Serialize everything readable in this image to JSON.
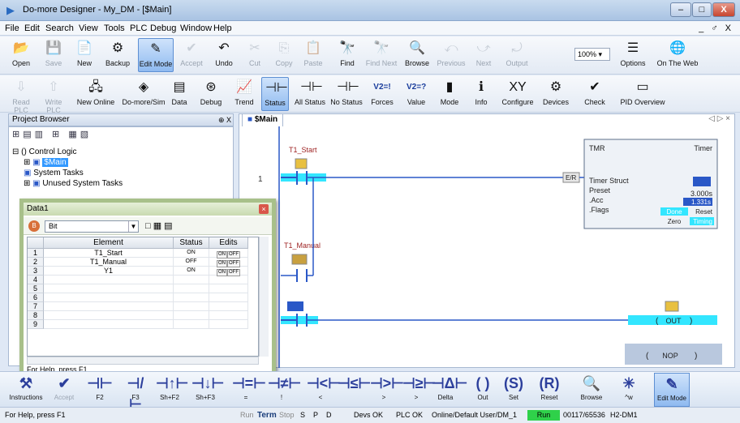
{
  "window": {
    "title": "Do-more Designer - My_DM - [$Main]",
    "min": "–",
    "max": "□",
    "close": "X",
    "mdi_controls": "_ ♂ X"
  },
  "menu": [
    "File",
    "Edit",
    "Search",
    "View",
    "Tools",
    "PLC",
    "Debug",
    "Window",
    "Help"
  ],
  "toolbar1": [
    {
      "label": "Open",
      "icon": "folder-open-icon",
      "glyph": "📂",
      "state": "normal"
    },
    {
      "label": "Save",
      "icon": "save-icon",
      "glyph": "💾",
      "state": "disabled"
    },
    {
      "label": "New",
      "icon": "new-document-icon",
      "glyph": "📄",
      "state": "normal"
    },
    {
      "label": "Backup",
      "icon": "backup-icon",
      "glyph": "⚙",
      "state": "normal"
    },
    {
      "label": "Edit Mode",
      "icon": "edit-mode-icon",
      "glyph": "✎",
      "state": "selected"
    },
    {
      "label": "Accept",
      "icon": "accept-icon",
      "glyph": "✔",
      "state": "disabled"
    },
    {
      "label": "Undo",
      "icon": "undo-icon",
      "glyph": "↶",
      "state": "normal"
    },
    {
      "label": "Cut",
      "icon": "cut-icon",
      "glyph": "✂",
      "state": "disabled"
    },
    {
      "label": "Copy",
      "icon": "copy-icon",
      "glyph": "⎘",
      "state": "disabled"
    },
    {
      "label": "Paste",
      "icon": "paste-icon",
      "glyph": "📋",
      "state": "disabled"
    },
    {
      "label": "Find",
      "icon": "find-icon",
      "glyph": "🔭",
      "state": "normal"
    },
    {
      "label": "Find Next",
      "icon": "find-next-icon",
      "glyph": "🔭",
      "state": "disabled"
    },
    {
      "label": "Browse",
      "icon": "browse-icon",
      "glyph": "🔍",
      "state": "normal"
    },
    {
      "label": "Previous",
      "icon": "previous-icon",
      "glyph": "⤺",
      "state": "disabled"
    },
    {
      "label": "Next",
      "icon": "next-icon",
      "glyph": "⤻",
      "state": "disabled"
    },
    {
      "label": "Output",
      "icon": "output-icon",
      "glyph": "⤾",
      "state": "disabled"
    },
    {
      "label": "Options",
      "icon": "options-icon",
      "glyph": "☰",
      "state": "normal"
    },
    {
      "label": "On The Web",
      "icon": "web-icon",
      "glyph": "🌐",
      "state": "normal"
    }
  ],
  "zoom": "100%",
  "toolbar2": [
    {
      "label": "Read PLC",
      "icon": "read-plc-icon",
      "glyph": "⇩",
      "state": "disabled"
    },
    {
      "label": "Write PLC",
      "icon": "write-plc-icon",
      "glyph": "⇧",
      "state": "disabled"
    },
    {
      "label": "New Online",
      "icon": "new-online-icon",
      "glyph": "🖧",
      "state": "normal"
    },
    {
      "label": "Do-more/Sim",
      "icon": "sim-icon",
      "glyph": "◈",
      "state": "normal"
    },
    {
      "label": "Data",
      "icon": "data-icon",
      "glyph": "▤",
      "state": "normal"
    },
    {
      "label": "Debug",
      "icon": "debug-icon",
      "glyph": "⊛",
      "state": "normal"
    },
    {
      "label": "Trend",
      "icon": "trend-icon",
      "glyph": "📈",
      "state": "normal"
    },
    {
      "label": "Status",
      "icon": "status-icon",
      "glyph": "⊣⊢",
      "state": "selected"
    },
    {
      "label": "All Status",
      "icon": "all-status-icon",
      "glyph": "⊣⊢",
      "state": "normal"
    },
    {
      "label": "No Status",
      "icon": "no-status-icon",
      "glyph": "⊣⊢",
      "state": "normal"
    },
    {
      "label": "Forces",
      "icon": "forces-icon",
      "glyph": "V2=!",
      "state": "normal"
    },
    {
      "label": "Value",
      "icon": "value-icon",
      "glyph": "V2=?",
      "state": "normal"
    },
    {
      "label": "Mode",
      "icon": "mode-icon",
      "glyph": "▮",
      "state": "normal"
    },
    {
      "label": "Info",
      "icon": "info-icon",
      "glyph": "ℹ",
      "state": "normal"
    },
    {
      "label": "Configure",
      "icon": "configure-icon",
      "glyph": "XY",
      "state": "normal"
    },
    {
      "label": "Devices",
      "icon": "devices-icon",
      "glyph": "⚙",
      "state": "normal"
    },
    {
      "label": "Check",
      "icon": "check-icon",
      "glyph": "✔",
      "state": "normal"
    },
    {
      "label": "PID Overview",
      "icon": "pid-icon",
      "glyph": "▭",
      "state": "normal"
    }
  ],
  "project_browser": {
    "title": "Project Browser",
    "pin": "⊕ X",
    "tree": [
      {
        "label": "() Control Logic",
        "level": 0,
        "expander": "⊟",
        "selected": false
      },
      {
        "label": "$Main",
        "level": 1,
        "expander": "⊞",
        "selected": true
      },
      {
        "label": "System Tasks",
        "level": 1,
        "expander": "",
        "selected": false
      },
      {
        "label": "Unused System Tasks",
        "level": 1,
        "expander": "⊞",
        "selected": false
      }
    ]
  },
  "doc": {
    "tab": "$Main",
    "nav": "◁ ▷ ×"
  },
  "ladder": {
    "rung1_number": "1",
    "contact1_label": "T1_Start",
    "contact2_label": "T1_Manual",
    "er_label": "E/R",
    "timer": {
      "mnemonic": "TMR",
      "name": "Timer",
      "struct_label": "Timer Struct",
      "preset_label": "Preset",
      "preset_value": "3.000s",
      "acc_label": ".Acc",
      "acc_value": "1.331s",
      "flags_label": ".Flags",
      "done": "Done",
      "reset": "Reset",
      "zero": "Zero",
      "timing": "Timing"
    },
    "out_label": "OUT",
    "nop_label": "NOP"
  },
  "data_window": {
    "title": "Data1",
    "close": "×",
    "type": "Bit",
    "columns": [
      "Element",
      "Status",
      "Edits"
    ],
    "rows": [
      {
        "n": "1",
        "element": "T1_Start",
        "status": "ON"
      },
      {
        "n": "2",
        "element": "T1_Manual",
        "status": "OFF"
      },
      {
        "n": "3",
        "element": "Y1",
        "status": "ON"
      },
      {
        "n": "4",
        "element": "",
        "status": ""
      },
      {
        "n": "5",
        "element": "",
        "status": ""
      },
      {
        "n": "6",
        "element": "",
        "status": ""
      },
      {
        "n": "7",
        "element": "",
        "status": ""
      },
      {
        "n": "8",
        "element": "",
        "status": ""
      },
      {
        "n": "9",
        "element": "",
        "status": ""
      }
    ],
    "toggle_on": "ON",
    "toggle_off": "OFF",
    "status_text": "For Help, press F1"
  },
  "instruction_bar": [
    {
      "label": "Instructions",
      "glyph": "⚒",
      "state": "normal"
    },
    {
      "label": "Accept",
      "glyph": "✔",
      "state": "disabled"
    },
    {
      "label": "F2",
      "glyph": "⊣⊢",
      "state": "normal"
    },
    {
      "label": "F3",
      "glyph": "⊣/⊢",
      "state": "normal"
    },
    {
      "label": "Sh+F2",
      "glyph": "⊣↑⊢",
      "state": "normal"
    },
    {
      "label": "Sh+F3",
      "glyph": "⊣↓⊢",
      "state": "normal"
    },
    {
      "label": "=",
      "glyph": "⊣=⊢",
      "state": "normal"
    },
    {
      "label": "!",
      "glyph": "⊣≠⊢",
      "state": "normal"
    },
    {
      "label": "<",
      "glyph": "⊣<⊢",
      "state": "normal"
    },
    {
      "label": "",
      "glyph": "⊣≤⊢",
      "state": "normal"
    },
    {
      "label": ">",
      "glyph": "⊣>⊢",
      "state": "normal"
    },
    {
      "label": ">",
      "glyph": "⊣≥⊢",
      "state": "normal"
    },
    {
      "label": "Delta",
      "glyph": "⊣Δ⊢",
      "state": "normal"
    },
    {
      "label": "Out",
      "glyph": "( )",
      "state": "normal"
    },
    {
      "label": "Set",
      "glyph": "(S)",
      "state": "normal"
    },
    {
      "label": "Reset",
      "glyph": "(R)",
      "state": "normal"
    },
    {
      "label": "Browse",
      "glyph": "🔍",
      "state": "normal"
    },
    {
      "label": "^w",
      "glyph": "✳",
      "state": "normal"
    },
    {
      "label": "Edit Mode",
      "glyph": "✎",
      "state": "selected"
    }
  ],
  "statusbar": {
    "help": "For Help, press F1",
    "run": "Run",
    "term": "Term",
    "stop": "Stop",
    "s": "S",
    "p": "P",
    "d": "D",
    "devs": "Devs OK",
    "plc": "PLC OK",
    "online": "Online/Default User/DM_1",
    "run_badge": "Run",
    "mem": "00117/65536",
    "model": "H2-DM1"
  },
  "colors": {
    "highlight": "#33e6ff",
    "selected_tree": "#3399ff",
    "rung_text": "#9c1f1f",
    "contact": "#2a58c7"
  }
}
